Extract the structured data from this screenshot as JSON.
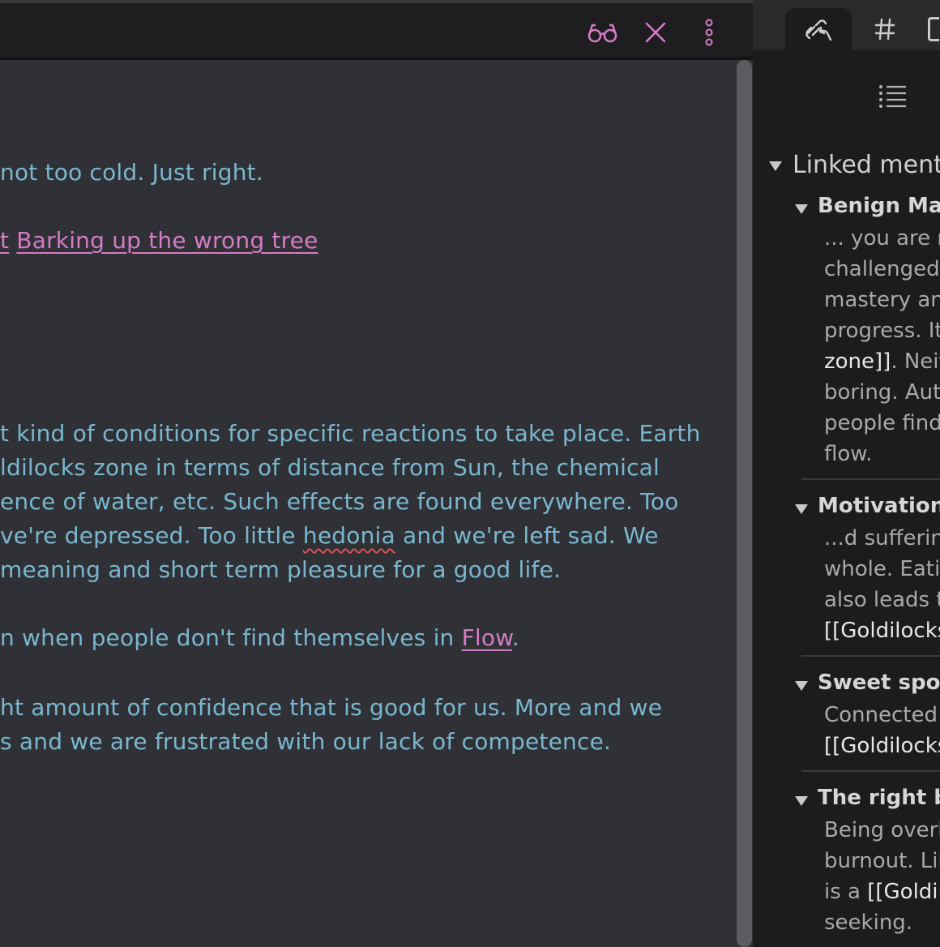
{
  "editor": {
    "toolbar": {
      "reading_view_icon": "glasses-icon",
      "close_icon": "close-icon",
      "more_icon": "more-options-icon"
    },
    "lines": {
      "l1": " not too cold. Just right.",
      "l2_prefix": "t",
      "l2_link": "Barking up the wrong tree",
      "l3": "t kind of conditions for specific reactions to take place. Earth",
      "l4": "ldilocks zone in terms of distance from Sun, the chemical",
      "l5": "ence of water, etc. Such effects are found everywhere. Too",
      "l6_pre": "ve're depressed. Too little ",
      "l6_misspelled": "hedonia",
      "l6_post": " and we're left sad. We",
      "l7": " meaning and short term pleasure for a good life.",
      "l8_pre": "n when people don't find themselves in ",
      "l8_link": "Flow",
      "l8_post": ".",
      "l9": "ht amount of confidence that is good for us. More and we",
      "l10": "s and we are frustrated with our lack of competence."
    },
    "colors": {
      "text": "#7ab7cf",
      "link": "#d67cc4"
    }
  },
  "sidebar": {
    "tabs": [
      "backlinks-icon",
      "tags-icon",
      "more-tab"
    ],
    "list_icon": "list-icon",
    "section_title": "Linked menti",
    "entries": [
      {
        "title": "Benign Mas",
        "lines": [
          "... you are r",
          "challenged",
          "mastery and",
          "progress. It",
          "zone]]",
          ". Neit",
          "boring. Aut",
          "people find",
          "flow."
        ]
      },
      {
        "title": "Motivationa",
        "lines": [
          "...d suffering",
          "whole. Eatir",
          "also leads t",
          "[[Goldilocks"
        ]
      },
      {
        "title": "Sweet spot",
        "lines": [
          "Connected",
          "[[Goldilocks"
        ]
      },
      {
        "title": "The right ba",
        "lines": [
          "Being overl",
          "burnout. Lik",
          "is a ",
          "[[Goldilo",
          "seeking."
        ]
      }
    ]
  }
}
